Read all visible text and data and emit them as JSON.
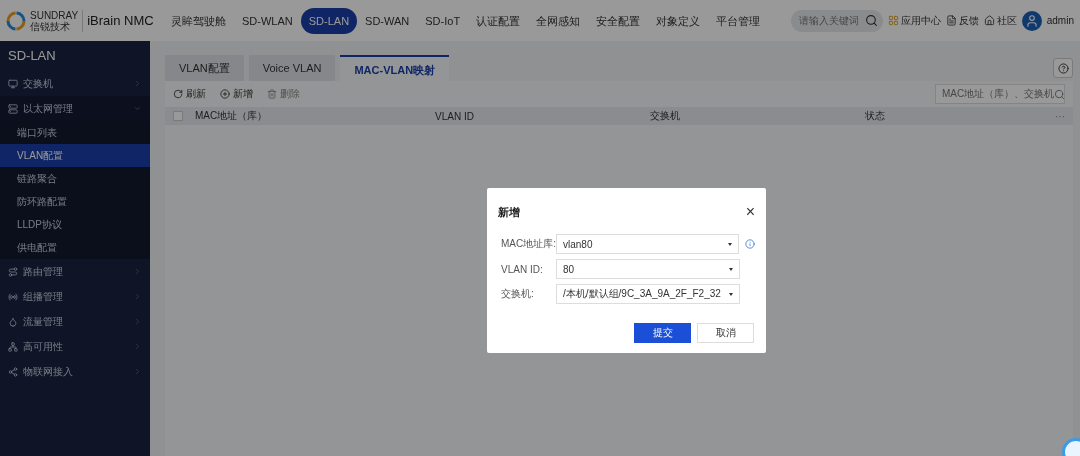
{
  "header": {
    "brand_small": [
      "SUNDRAY",
      "信锐技术"
    ],
    "product": "iBrain NMC",
    "nav": [
      {
        "label": "灵眸驾驶舱",
        "selected": false
      },
      {
        "label": "SD-WLAN",
        "selected": false
      },
      {
        "label": "SD-LAN",
        "selected": true
      },
      {
        "label": "SD-WAN",
        "selected": false
      },
      {
        "label": "SD-IoT",
        "selected": false
      },
      {
        "label": "认证配置",
        "selected": false
      },
      {
        "label": "全网感知",
        "selected": false
      },
      {
        "label": "安全配置",
        "selected": false
      },
      {
        "label": "对象定义",
        "selected": false
      },
      {
        "label": "平台管理",
        "selected": false
      }
    ],
    "search": {
      "placeholder": "请输入关键词"
    },
    "links": [
      {
        "kind": "apps",
        "label": "应用中心"
      },
      {
        "kind": "feedback",
        "label": "反馈"
      },
      {
        "kind": "community",
        "label": "社区"
      }
    ],
    "user": "admin"
  },
  "sidebar": {
    "title": "SD-LAN",
    "items": [
      {
        "label": "交换机",
        "expanded": false
      },
      {
        "label": "以太网管理",
        "expanded": true,
        "children": [
          {
            "label": "端口列表",
            "selected": false
          },
          {
            "label": "VLAN配置",
            "selected": true
          },
          {
            "label": "链路聚合",
            "selected": false
          },
          {
            "label": "防环路配置",
            "selected": false
          },
          {
            "label": "LLDP协议",
            "selected": false
          },
          {
            "label": "供电配置",
            "selected": false
          }
        ]
      },
      {
        "label": "路由管理",
        "expanded": false
      },
      {
        "label": "组播管理",
        "expanded": false
      },
      {
        "label": "流量管理",
        "expanded": false
      },
      {
        "label": "高可用性",
        "expanded": false
      },
      {
        "label": "物联网接入",
        "expanded": false
      }
    ]
  },
  "tabs": [
    {
      "label": "VLAN配置",
      "selected": false
    },
    {
      "label": "Voice VLAN",
      "selected": false
    },
    {
      "label": "MAC-VLAN映射",
      "selected": true
    }
  ],
  "toolbar": [
    {
      "kind": "refresh",
      "label": "刷新",
      "disabled": false
    },
    {
      "kind": "add",
      "label": "新增",
      "disabled": false
    },
    {
      "kind": "delete",
      "label": "删除",
      "disabled": true
    }
  ],
  "table_search": {
    "placeholder": "MAC地址（库）、交换机"
  },
  "table": {
    "select_all": {
      "checked": false
    },
    "columns": [
      "MAC地址（库）",
      "VLAN ID",
      "交换机",
      "状态"
    ],
    "more": "···"
  },
  "dialog": {
    "title": "新增",
    "close": "×",
    "fields": [
      {
        "label": "MAC地址库:",
        "value": "vlan80",
        "info": true
      },
      {
        "label": "VLAN ID:",
        "value": "80",
        "info": false
      },
      {
        "label": "交换机:",
        "value": "/本机/默认组/9C_3A_9A_2F_F2_32",
        "info": false
      }
    ],
    "buttons": [
      {
        "label": "提交",
        "primary": true
      },
      {
        "label": "取消",
        "primary": false
      }
    ]
  }
}
